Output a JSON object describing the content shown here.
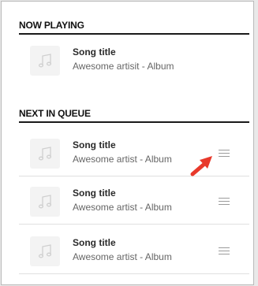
{
  "sections": {
    "now_playing": {
      "header": "NOW PLAYING",
      "items": [
        {
          "title": "Song title",
          "subtitle": "Awesome artisit - Album",
          "art_icon": "music-note-icon"
        }
      ]
    },
    "next_in_queue": {
      "header": "NEXT IN QUEUE",
      "items": [
        {
          "title": "Song title",
          "subtitle": "Awesome artist - Album",
          "art_icon": "music-note-icon",
          "drag_icon": "drag-handle-icon"
        },
        {
          "title": "Song title",
          "subtitle": "Awesome artist - Album",
          "art_icon": "music-note-icon",
          "drag_icon": "drag-handle-icon"
        },
        {
          "title": "Song title",
          "subtitle": "Awesome artist - Album",
          "art_icon": "music-note-icon",
          "drag_icon": "drag-handle-icon"
        }
      ]
    }
  },
  "annotation": {
    "icon": "red-arrow-icon",
    "color": "#e8392b"
  },
  "colors": {
    "header_rule": "#1a1a1a",
    "art_bg": "#f3f3f3",
    "icon_stroke": "#cfcfcf"
  }
}
